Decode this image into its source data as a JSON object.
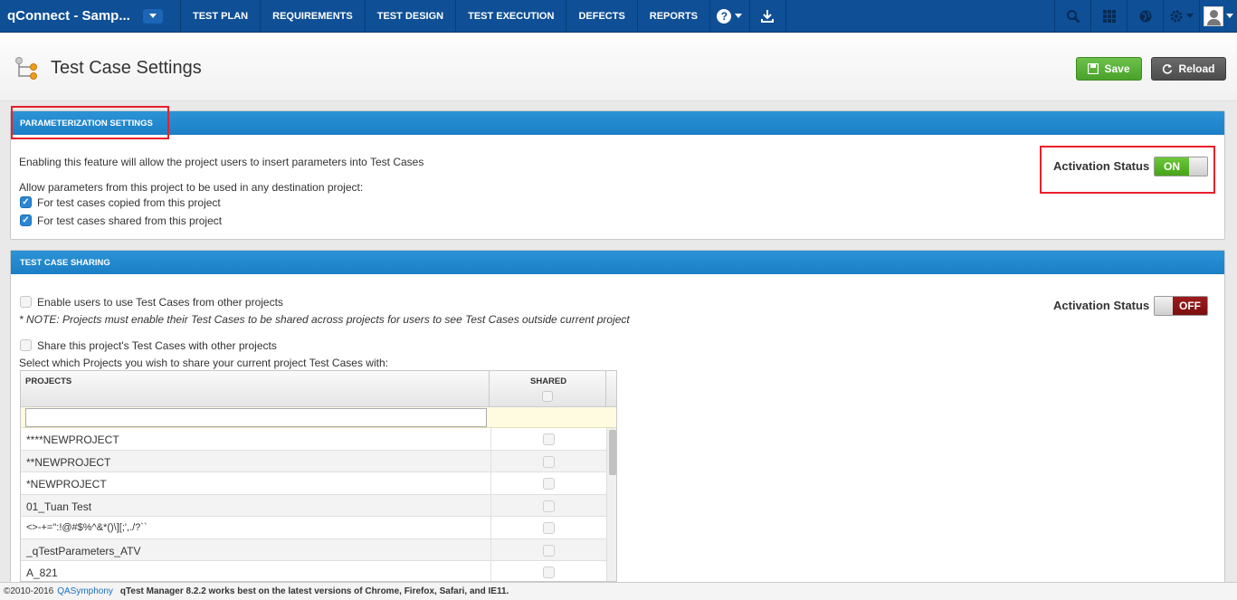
{
  "app": {
    "title": "qConnect - Samp..."
  },
  "nav": {
    "items": [
      "TEST PLAN",
      "REQUIREMENTS",
      "TEST DESIGN",
      "TEST EXECUTION",
      "DEFECTS",
      "REPORTS"
    ],
    "help_glyph": "?",
    "icons": [
      "help-icon",
      "download-icon",
      "search-icon",
      "apps-grid-icon",
      "globe-icon",
      "gear-icon",
      "avatar"
    ]
  },
  "page": {
    "title": "Test Case Settings",
    "save_label": "Save",
    "reload_label": "Reload"
  },
  "parameterization": {
    "header": "PARAMETERIZATION SETTINGS",
    "description": "Enabling this feature will allow the project users to insert parameters into Test Cases",
    "allow_label": "Allow parameters from this project to be used in any destination project:",
    "option_copied": "For test cases copied from this project",
    "option_shared": "For test cases shared from this project",
    "activation_label": "Activation Status",
    "toggle_state": "ON"
  },
  "sharing": {
    "header": "TEST CASE SHARING",
    "enable_label": "Enable users to use Test Cases from other projects",
    "note": "* NOTE: Projects must enable their Test Cases to be shared across projects for users to see Test Cases outside current project",
    "share_label": "Share this project's Test Cases with other projects",
    "select_label": "Select which Projects you wish to share your current project Test Cases with:",
    "activation_label": "Activation Status",
    "toggle_state": "OFF",
    "col_projects": "PROJECTS",
    "col_shared": "SHARED",
    "projects": [
      "****NEWPROJECT",
      "**NEWPROJECT",
      "*NEWPROJECT",
      "01_Tuan Test",
      "<>-+=\":!@#$%^&*()\\][;',./?``",
      "_qTestParameters_ATV",
      "A_821"
    ]
  },
  "footer": {
    "copyright": "©2010-2016",
    "company": "QASymphony",
    "notice": "qTest Manager 8.2.2 works best on the latest versions of Chrome, Firefox, Safari, and IE11."
  },
  "colors": {
    "nav_bg": "#0e4f96",
    "panel_header": "#1b7fc6",
    "save_green": "#4aa22a",
    "toggle_on": "#46a317",
    "toggle_off": "#7a0f0f",
    "highlight_red": "#e8202a"
  }
}
